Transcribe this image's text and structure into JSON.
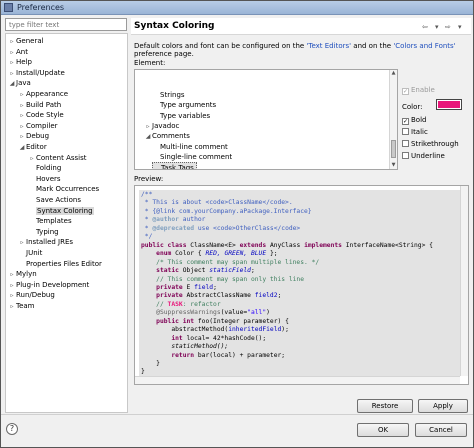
{
  "window": {
    "title": "Preferences"
  },
  "filter": {
    "placeholder": "type filter text"
  },
  "tree": [
    {
      "label": "General",
      "twisty": "▹",
      "depth": 0
    },
    {
      "label": "Ant",
      "twisty": "▹",
      "depth": 0
    },
    {
      "label": "Help",
      "twisty": "▹",
      "depth": 0
    },
    {
      "label": "Install/Update",
      "twisty": "▹",
      "depth": 0
    },
    {
      "label": "Java",
      "twisty": "◢",
      "depth": 0
    },
    {
      "label": "Appearance",
      "twisty": "▹",
      "depth": 1
    },
    {
      "label": "Build Path",
      "twisty": "▹",
      "depth": 1
    },
    {
      "label": "Code Style",
      "twisty": "▹",
      "depth": 1
    },
    {
      "label": "Compiler",
      "twisty": "▹",
      "depth": 1
    },
    {
      "label": "Debug",
      "twisty": "▹",
      "depth": 1
    },
    {
      "label": "Editor",
      "twisty": "◢",
      "depth": 1
    },
    {
      "label": "Content Assist",
      "twisty": "▹",
      "depth": 2
    },
    {
      "label": "Folding",
      "twisty": "",
      "depth": 2
    },
    {
      "label": "Hovers",
      "twisty": "",
      "depth": 2
    },
    {
      "label": "Mark Occurrences",
      "twisty": "",
      "depth": 2
    },
    {
      "label": "Save Actions",
      "twisty": "",
      "depth": 2
    },
    {
      "label": "Syntax Coloring",
      "twisty": "",
      "depth": 2,
      "selected": true
    },
    {
      "label": "Templates",
      "twisty": "",
      "depth": 2
    },
    {
      "label": "Typing",
      "twisty": "",
      "depth": 2
    },
    {
      "label": "Installed JREs",
      "twisty": "▹",
      "depth": 1
    },
    {
      "label": "JUnit",
      "twisty": "",
      "depth": 1
    },
    {
      "label": "Properties Files Editor",
      "twisty": "",
      "depth": 1
    },
    {
      "label": "Mylyn",
      "twisty": "▹",
      "depth": 0
    },
    {
      "label": "Plug-in Development",
      "twisty": "▹",
      "depth": 0
    },
    {
      "label": "Run/Debug",
      "twisty": "▹",
      "depth": 0
    },
    {
      "label": "Team",
      "twisty": "▹",
      "depth": 0
    }
  ],
  "page": {
    "title": "Syntax Coloring",
    "nav_back": "⇦",
    "nav_forward": "⇨",
    "nav_menu": "▾",
    "desc_pre": "Default colors and font can be configured on the ",
    "desc_link1": "'Text Editors'",
    "desc_mid": " and on the ",
    "desc_link2": "'Colors and Fonts'",
    "desc_post": " preference page.",
    "element_label": "Element:",
    "preview_label": "Preview:"
  },
  "elements": [
    {
      "label": "Strings",
      "twisty": "",
      "depth": 2
    },
    {
      "label": "Type arguments",
      "twisty": "",
      "depth": 2
    },
    {
      "label": "Type variables",
      "twisty": "",
      "depth": 2
    },
    {
      "label": "Javadoc",
      "twisty": "▹",
      "depth": 1
    },
    {
      "label": "Comments",
      "twisty": "◢",
      "depth": 1
    },
    {
      "label": "Multi-line comment",
      "twisty": "",
      "depth": 2
    },
    {
      "label": "Single-line comment",
      "twisty": "",
      "depth": 2
    },
    {
      "label": "Task Tags",
      "twisty": "",
      "depth": 2,
      "selected": true
    }
  ],
  "options": {
    "enable": {
      "label": "Enable",
      "checked": true
    },
    "color_label": "Color:",
    "color": "#e8177a",
    "bold": {
      "label": "Bold",
      "checked": true
    },
    "italic": {
      "label": "Italic",
      "checked": false
    },
    "strikethrough": {
      "label": "Strikethrough",
      "checked": false
    },
    "underline": {
      "label": "Underline",
      "checked": false
    }
  },
  "code_colors": {
    "keyword": "#7f0055",
    "javadoc": "#3f5fbf",
    "javadoc_tag": "#7f9fbf",
    "comment": "#3f7f5f",
    "field": "#0000c0",
    "enum": "#0000c0",
    "string": "#2a00ff",
    "annotation": "#646464",
    "task": "#e8177a",
    "plain": "#000000"
  },
  "code": [
    [
      [
        "javadoc",
        "/**"
      ]
    ],
    [
      [
        "javadoc",
        " * This is about <code>ClassName</code>."
      ]
    ],
    [
      [
        "javadoc",
        " * {@link com.yourCompany.aPackage.Interface}"
      ]
    ],
    [
      [
        "javadoc",
        " * "
      ],
      [
        "javadoc_tag",
        "@author"
      ],
      [
        "javadoc",
        " author"
      ]
    ],
    [
      [
        "javadoc",
        " * "
      ],
      [
        "javadoc_tag",
        "@deprecated"
      ],
      [
        "javadoc",
        " use <code>OtherClass</code>"
      ]
    ],
    [
      [
        "javadoc",
        " */"
      ]
    ],
    [
      [
        "keyword",
        "public class "
      ],
      [
        "plain",
        "ClassName<E> "
      ],
      [
        "keyword",
        "extends "
      ],
      [
        "plain",
        "AnyClass "
      ],
      [
        "keyword",
        "implements "
      ],
      [
        "plain",
        "InterfaceName<String> {"
      ]
    ],
    [
      [
        "plain",
        "    "
      ],
      [
        "keyword",
        "enum "
      ],
      [
        "plain",
        "Color { "
      ],
      [
        "enum",
        "RED, GREEN, BLUE"
      ],
      [
        "plain",
        " };"
      ]
    ],
    [
      [
        "comment",
        "    /* This comment may span multiple lines. */"
      ]
    ],
    [
      [
        "plain",
        "    "
      ],
      [
        "keyword",
        "static "
      ],
      [
        "plain",
        "Object "
      ],
      [
        "field",
        "staticField"
      ],
      [
        "plain",
        ";"
      ]
    ],
    [
      [
        "comment",
        "    // This comment may span only this line"
      ]
    ],
    [
      [
        "plain",
        "    "
      ],
      [
        "keyword",
        "private "
      ],
      [
        "plain",
        "E "
      ],
      [
        "field",
        "field"
      ],
      [
        "plain",
        ";"
      ]
    ],
    [
      [
        "plain",
        "    "
      ],
      [
        "keyword",
        "private "
      ],
      [
        "plain",
        "AbstractClassName "
      ],
      [
        "field",
        "field2"
      ],
      [
        "plain",
        ";"
      ]
    ],
    [
      [
        "comment",
        "    // "
      ],
      [
        "task",
        "TASK"
      ],
      [
        "comment",
        ": refactor"
      ]
    ],
    [
      [
        "plain",
        "    "
      ],
      [
        "annotation",
        "@SuppressWarnings"
      ],
      [
        "plain",
        "(value="
      ],
      [
        "string",
        "\"all\""
      ],
      [
        "plain",
        ")"
      ]
    ],
    [
      [
        "plain",
        "    "
      ],
      [
        "keyword",
        "public int "
      ],
      [
        "plain",
        "foo(Integer parameter) {"
      ]
    ],
    [
      [
        "plain",
        "        abstractMethod("
      ],
      [
        "field",
        "inheritedField"
      ],
      [
        "plain",
        ");"
      ]
    ],
    [
      [
        "plain",
        "        "
      ],
      [
        "keyword",
        "int "
      ],
      [
        "plain",
        "local= 42*hashCode();"
      ]
    ],
    [
      [
        "plain",
        "        staticMethod();"
      ]
    ],
    [
      [
        "plain",
        "        "
      ],
      [
        "keyword",
        "return "
      ],
      [
        "plain",
        "bar(local) + parameter;"
      ]
    ],
    [
      [
        "plain",
        "    }"
      ]
    ],
    [
      [
        "plain",
        "}"
      ]
    ]
  ],
  "buttons": {
    "restore_defaults": "Restore Defaults",
    "apply": "Apply",
    "ok": "OK",
    "cancel": "Cancel",
    "help": "?"
  }
}
